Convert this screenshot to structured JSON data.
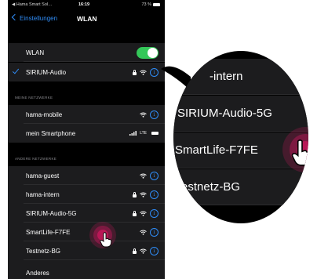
{
  "status_bar": {
    "left": "◀ Hama Smart Sol…",
    "time": "16:19",
    "right": "73 %"
  },
  "nav": {
    "back_label": "Einstellungen",
    "title": "WLAN"
  },
  "wlan_row": {
    "label": "WLAN",
    "on": true
  },
  "connected_network": {
    "name": "SIRIUM-Audio"
  },
  "sections": {
    "my_networks": "MEINE NETZWERKE",
    "other_networks": "ANDERE NETZWERKE"
  },
  "my_networks": [
    {
      "name": "hama-mobile"
    },
    {
      "name": "mein Smartphone",
      "hotspot": "LTE"
    }
  ],
  "other_networks": [
    {
      "name": "hama-guest",
      "locked": false
    },
    {
      "name": "hama-intern",
      "locked": true
    },
    {
      "name": "SIRIUM-Audio-5G",
      "locked": true
    },
    {
      "name": "SmartLife-F7FE",
      "locked": false
    },
    {
      "name": "Testnetz-BG",
      "locked": true
    },
    {
      "name": "Anderes"
    }
  ],
  "info_glyph": "i",
  "magnifier": {
    "rows": [
      "-intern",
      "SIRIUM-Audio-5G",
      "SmartLife-F7FE",
      "estnetz-BG"
    ]
  },
  "colors": {
    "accent": "#2f8cf6",
    "toggle_on": "#34c759",
    "tap": "#c2185b"
  }
}
